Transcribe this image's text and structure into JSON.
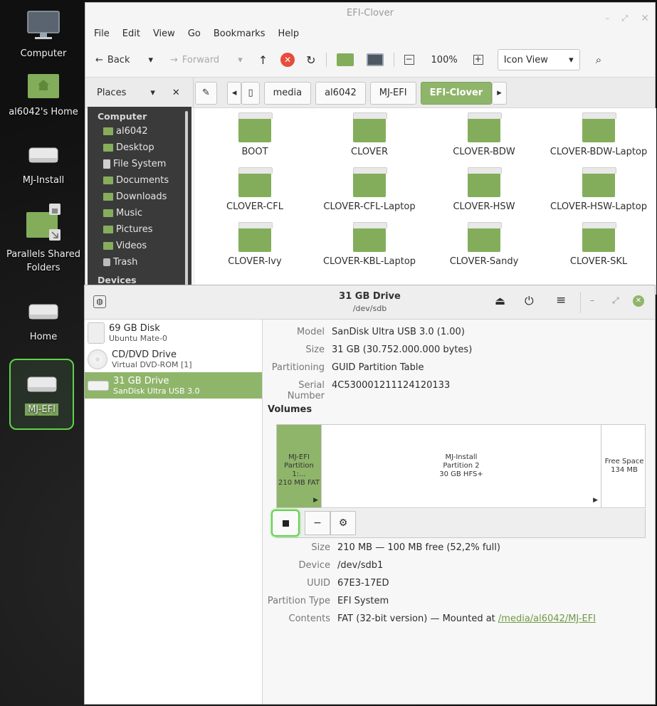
{
  "desktop": {
    "icons": [
      {
        "label": "Computer"
      },
      {
        "label": "al6042's Home"
      },
      {
        "label": "MJ-Install"
      },
      {
        "label": "Parallels Shared Folders"
      },
      {
        "label": "Home"
      },
      {
        "label": "MJ-EFI"
      }
    ]
  },
  "file_manager": {
    "title": "EFI-Clover",
    "menu": [
      "File",
      "Edit",
      "View",
      "Go",
      "Bookmarks",
      "Help"
    ],
    "toolbar": {
      "back": "Back",
      "forward": "Forward",
      "zoom": "100%",
      "view": "Icon View"
    },
    "places_label": "Places",
    "breadcrumbs": [
      "media",
      "al6042",
      "MJ-EFI",
      "EFI-Clover"
    ],
    "sidebar": {
      "computer_header": "Computer",
      "items": [
        "al6042",
        "Desktop",
        "File System",
        "Documents",
        "Downloads",
        "Music",
        "Pictures",
        "Videos",
        "Trash"
      ],
      "devices_header": "Devices"
    },
    "folders": [
      "BOOT",
      "CLOVER",
      "CLOVER-BDW",
      "CLOVER-BDW-Laptop",
      "CLOVER-CFL",
      "CLOVER-CFL-Laptop",
      "CLOVER-HSW",
      "CLOVER-HSW-Laptop",
      "CLOVER-Ivy",
      "CLOVER-KBL-Laptop",
      "CLOVER-Sandy",
      "CLOVER-SKL"
    ],
    "accent": "#8fb56a"
  },
  "disks": {
    "title": "31 GB Drive",
    "subtitle": "/dev/sdb",
    "drives": [
      {
        "name": "69 GB Disk",
        "sub": "Ubuntu Mate-0"
      },
      {
        "name": "CD/DVD Drive",
        "sub": "Virtual DVD-ROM [1]"
      },
      {
        "name": "31 GB Drive",
        "sub": "SanDisk Ultra USB 3.0"
      }
    ],
    "details": {
      "model_k": "Model",
      "model_v": "SanDisk Ultra USB 3.0 (1.00)",
      "size_k": "Size",
      "size_v": "31 GB (30.752.000.000 bytes)",
      "part_k": "Partitioning",
      "part_v": "GUID Partition Table",
      "serial_k": "Serial Number",
      "serial_v": "4C530001211124120133"
    },
    "volumes_label": "Volumes",
    "partitions": [
      {
        "l1": "MJ-EFI",
        "l2": "Partition 1:...",
        "l3": "210 MB FAT"
      },
      {
        "l1": "MJ-Install",
        "l2": "Partition 2",
        "l3": "30 GB HFS+"
      },
      {
        "l1": "Free Space",
        "l2": "134 MB"
      }
    ],
    "volume_info": {
      "size_k": "Size",
      "size_v": "210 MB — 100 MB free (52,2% full)",
      "device_k": "Device",
      "device_v": "/dev/sdb1",
      "uuid_k": "UUID",
      "uuid_v": "67E3-17ED",
      "ptype_k": "Partition Type",
      "ptype_v": "EFI System",
      "contents_k": "Contents",
      "contents_v": "FAT (32-bit version) — Mounted at ",
      "mount_link": "/media/al6042/MJ-EFI"
    }
  }
}
